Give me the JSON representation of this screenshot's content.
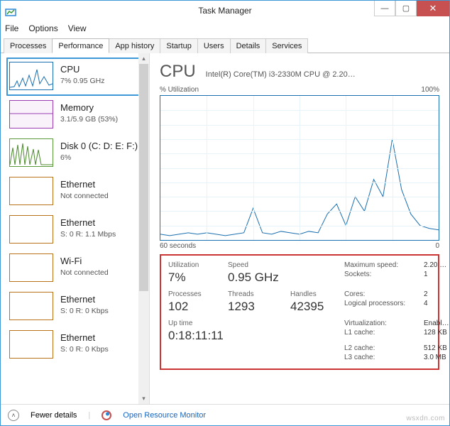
{
  "titlebar": {
    "title": "Task Manager"
  },
  "menu": {
    "file": "File",
    "options": "Options",
    "view": "View"
  },
  "tabs": {
    "processes": "Processes",
    "performance": "Performance",
    "app_history": "App history",
    "startup": "Startup",
    "users": "Users",
    "details": "Details",
    "services": "Services"
  },
  "sidebar": {
    "items": [
      {
        "title": "CPU",
        "sub": "7% 0.95 GHz"
      },
      {
        "title": "Memory",
        "sub": "3.1/5.9 GB (53%)"
      },
      {
        "title": "Disk 0 (C: D: E: F:)",
        "sub": "6%"
      },
      {
        "title": "Ethernet",
        "sub": "Not connected"
      },
      {
        "title": "Ethernet",
        "sub": "S: 0 R: 1.1 Mbps"
      },
      {
        "title": "Wi-Fi",
        "sub": "Not connected"
      },
      {
        "title": "Ethernet",
        "sub": "S: 0 R: 0 Kbps"
      },
      {
        "title": "Ethernet",
        "sub": "S: 0 R: 0 Kbps"
      }
    ]
  },
  "main": {
    "title": "CPU",
    "subtitle": "Intel(R) Core(TM) i3-2330M CPU @ 2.20…",
    "util_label": "% Utilization",
    "util_max": "100%",
    "x_left": "60 seconds",
    "x_right": "0"
  },
  "stats": {
    "utilization_lbl": "Utilization",
    "utilization": "7%",
    "speed_lbl": "Speed",
    "speed": "0.95 GHz",
    "processes_lbl": "Processes",
    "processes": "102",
    "threads_lbl": "Threads",
    "threads": "1293",
    "handles_lbl": "Handles",
    "handles": "42395",
    "uptime_lbl": "Up time",
    "uptime": "0:18:11:11",
    "max_speed_lbl": "Maximum speed:",
    "max_speed": "2.20 …",
    "sockets_lbl": "Sockets:",
    "sockets": "1",
    "cores_lbl": "Cores:",
    "cores": "2",
    "logical_lbl": "Logical processors:",
    "logical": "4",
    "virt_lbl": "Virtualization:",
    "virt": "Enabl…",
    "l1_lbl": "L1 cache:",
    "l1": "128 KB",
    "l2_lbl": "L2 cache:",
    "l2": "512 KB",
    "l3_lbl": "L3 cache:",
    "l3": "3.0 MB"
  },
  "footer": {
    "fewer": "Fewer details",
    "rm": "Open Resource Monitor"
  },
  "chart_data": {
    "type": "line",
    "title": "% Utilization",
    "xlabel": "seconds ago",
    "ylabel": "%",
    "ylim": [
      0,
      100
    ],
    "x": [
      60,
      58,
      56,
      54,
      52,
      50,
      48,
      46,
      44,
      42,
      40,
      38,
      36,
      34,
      32,
      30,
      28,
      26,
      24,
      22,
      20,
      18,
      16,
      14,
      12,
      10,
      8,
      6,
      4,
      2,
      0
    ],
    "values": [
      4,
      3,
      4,
      5,
      4,
      5,
      4,
      3,
      4,
      5,
      22,
      5,
      4,
      6,
      5,
      4,
      6,
      5,
      18,
      25,
      10,
      30,
      20,
      42,
      30,
      70,
      35,
      18,
      10,
      8,
      7
    ]
  },
  "watermark": "wsxdn.com"
}
